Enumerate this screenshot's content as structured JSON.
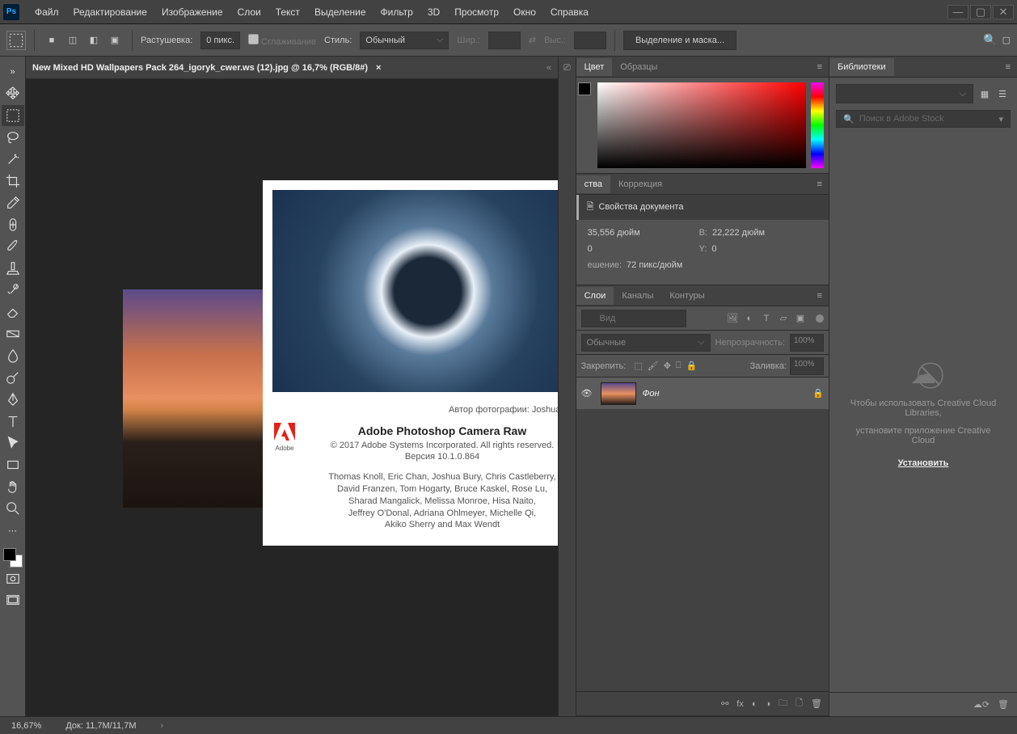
{
  "menu": [
    "Файл",
    "Редактирование",
    "Изображение",
    "Слои",
    "Текст",
    "Выделение",
    "Фильтр",
    "3D",
    "Просмотр",
    "Окно",
    "Справка"
  ],
  "options": {
    "feather_label": "Растушевка:",
    "feather_value": "0 пикс.",
    "antialias_label": "Сглаживание",
    "style_label": "Стиль:",
    "style_value": "Обычный",
    "width_label": "Шир.:",
    "height_label": "Выс.:",
    "mask_button": "Выделение и маска..."
  },
  "doc_tab": "New Mixed HD Wallpapers Pack 264_igoryk_cwer.ws (12).jpg @ 16,7% (RGB/8#)",
  "about": {
    "photo_credit": "Автор фотографии: Joshua Bury",
    "title": "Adobe Photoshop Camera Raw",
    "copyright": "© 2017 Adobe Systems Incorporated. All rights reserved.",
    "version": "Версия 10.1.0.864",
    "logo_label": "Adobe",
    "names1": "Thomas Knoll, Eric Chan, Joshua Bury, Chris Castleberry,",
    "names2": "David Franzen, Tom Hogarty, Bruce Kaskel, Rose Lu,",
    "names3": "Sharad Mangalick, Melissa Monroe, Hisa Naito,",
    "names4": "Jeffrey O'Donal, Adriana Ohlmeyer, Michelle Qi,",
    "names5": "Akiko Sherry and Max Wendt"
  },
  "color_panel": {
    "tab1": "Цвет",
    "tab2": "Образцы"
  },
  "props_panel": {
    "tab1": "ства",
    "tab2": "Коррекция",
    "header": "Свойства документа",
    "w_val": "35,556 дюйм",
    "h_label": "В:",
    "h_val": "22,222 дюйм",
    "x_val": "0",
    "y_label": "Y:",
    "y_val": "0",
    "res_label": "ешение:",
    "res_val": "72 пикс/дюйм"
  },
  "layers_panel": {
    "tab1": "Слои",
    "tab2": "Каналы",
    "tab3": "Контуры",
    "search_placeholder": "Вид",
    "blend_mode": "Обычные",
    "opacity_label": "Непрозрачность:",
    "opacity_val": "100%",
    "lock_label": "Закрепить:",
    "fill_label": "Заливка:",
    "fill_val": "100%",
    "layer_name": "Фон"
  },
  "lib_panel": {
    "tab": "Библиотеки",
    "search_placeholder": "Поиск в Adobe Stock",
    "msg1": "Чтобы использовать Creative Cloud Libraries,",
    "msg2": "установите приложение Creative Cloud",
    "install": "Установить"
  },
  "status": {
    "zoom": "16,67%",
    "doc": "Док: 11,7M/11,7M"
  }
}
